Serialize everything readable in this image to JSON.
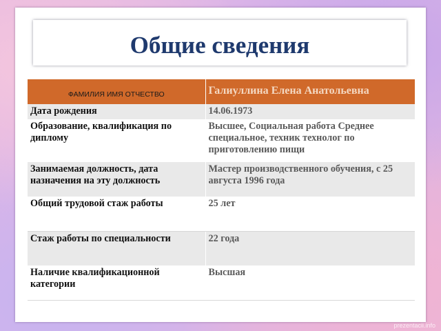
{
  "slide": {
    "title": "Общие сведения"
  },
  "table": {
    "header": {
      "label": "ФАМИЛИЯ ИМЯ ОТЧЕСТВО",
      "value": "Галиуллина Елена Анатольевна"
    },
    "rows": [
      {
        "label": "Дата рождения",
        "value": "14.06.1973"
      },
      {
        "label": "Образование, квалификация по диплому",
        "value": "Высшее, Социальная работа Среднее специальное, техник технолог по приготовлению пищи"
      },
      {
        "label": "Занимаемая должность, дата назначения  на эту должность",
        "value": "Мастер производственного обучения,  с 25 августа 1996 года"
      },
      {
        "label": "Общий трудовой стаж работы",
        "value": "25 лет"
      },
      {
        "label": "Стаж работы по специальности",
        "value": "22 года"
      },
      {
        "label": "Наличие квалификационной категории",
        "value": "Высшая"
      }
    ]
  },
  "watermark": "prezentacii.info",
  "colors": {
    "header_bg": "#d0692a",
    "title": "#1f3a6e",
    "row_alt": "#e9e9e9"
  }
}
